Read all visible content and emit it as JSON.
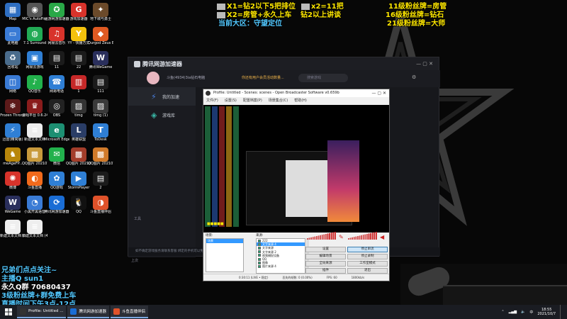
{
  "overlay": {
    "line1_left": "X1=钻2以下5把排位",
    "line1_mid": "x2=11把",
    "line2_left": "X2=房管+永久上车",
    "line2_mid": "钻2以上讲谈",
    "line3_left": "当前大区：守望定位",
    "right1": "11级粉丝牌=房管",
    "right2": "16级粉丝牌=钻石",
    "right3": "21级粉丝牌=大师",
    "bottom1": "兄弟们点点关注~",
    "bottom2": "主播Q  sun1",
    "bottom3": "永久Q群 70680437",
    "bottom4": "3级粉丝牌+群免费上车",
    "bottom5": "直播时间下午3点-12点"
  },
  "desktop_icons": [
    {
      "label": "Map",
      "color": "#2f6fc2",
      "glyph": "▦"
    },
    {
      "label": "MIC's AutoFire",
      "color": "#555555",
      "glyph": "◉"
    },
    {
      "label": "迅游网游加速器",
      "color": "#29a847",
      "glyph": "✪"
    },
    {
      "label": "游戏加速器",
      "color": "#d8332b",
      "glyph": "G"
    },
    {
      "label": "地下城与勇士",
      "color": "#6b4a2a",
      "glyph": "✦"
    },
    {
      "label": "此电脑",
      "color": "#3a7bd5",
      "glyph": "▭"
    },
    {
      "label": "7.1 Surround",
      "color": "#22aa55",
      "glyph": "◍"
    },
    {
      "label": "网易云音乐",
      "color": "#d8332b",
      "glyph": "♫"
    },
    {
      "label": "YY - 快播方式",
      "color": "#f4c20d",
      "glyph": "Y"
    },
    {
      "label": "Durgod Zeus Engine",
      "color": "#e05a22",
      "glyph": "◆"
    },
    {
      "label": "回收站",
      "color": "#4a6c8c",
      "glyph": "♻"
    },
    {
      "label": "网易云游戏",
      "color": "#2f7fd5",
      "glyph": "▣"
    },
    {
      "label": "11",
      "color": "#1b1b1b",
      "glyph": "▤"
    },
    {
      "label": "22",
      "color": "#1b1b1b",
      "glyph": "▤"
    },
    {
      "label": "腾讯WeGame",
      "color": "#2a2f5c",
      "glyph": "W"
    },
    {
      "label": "网络",
      "color": "#3a7bd5",
      "glyph": "◫"
    },
    {
      "label": "QQ音乐",
      "color": "#22b14c",
      "glyph": "♪"
    },
    {
      "label": "网易电话",
      "color": "#2f7fd5",
      "glyph": "☎"
    },
    {
      "label": "1",
      "color": "#c62828",
      "glyph": "▥"
    },
    {
      "label": "111",
      "color": "#1b1b1b",
      "glyph": "▤"
    },
    {
      "label": "Frozen Throne",
      "color": "#5c1a1a",
      "glyph": "❄"
    },
    {
      "label": "游戏平台 0.6.24",
      "color": "#8a1c1c",
      "glyph": "♛"
    },
    {
      "label": "OBS",
      "color": "#222222",
      "glyph": "◎"
    },
    {
      "label": "timg",
      "color": "#333333",
      "glyph": "▨"
    },
    {
      "label": "timg (1)",
      "color": "#3a3a3a",
      "glyph": "▨"
    },
    {
      "label": "迅雷(精简版)",
      "color": "#2f7fd5",
      "glyph": "⚡"
    },
    {
      "label": "新建文本文档",
      "color": "#eeeeee",
      "glyph": "≡"
    },
    {
      "label": "Microsoft Edge",
      "color": "#1d8f72",
      "glyph": "e"
    },
    {
      "label": "英雄联盟",
      "color": "#2a3d66",
      "glyph": "L"
    },
    {
      "label": "ToDesk",
      "color": "#2f7fd5",
      "glyph": "T"
    },
    {
      "label": "meAgeFP...",
      "color": "#b8860b",
      "glyph": "♞"
    },
    {
      "label": "QQ图片 20210731...",
      "color": "#c89a3c",
      "glyph": "▩"
    },
    {
      "label": "微信",
      "color": "#22b14c",
      "glyph": "✉"
    },
    {
      "label": "QQ图片 20210731...",
      "color": "#a33d2a",
      "glyph": "▩"
    },
    {
      "label": "QQ图片 20210731...",
      "color": "#d07a2a",
      "glyph": "▩"
    },
    {
      "label": "微博",
      "color": "#d8332b",
      "glyph": "✺"
    },
    {
      "label": "斗鱼直播",
      "color": "#f26a1b",
      "glyph": "◐"
    },
    {
      "label": "QQ游戏",
      "color": "#2f7fd5",
      "glyph": "✿"
    },
    {
      "label": "StormPlayer",
      "color": "#2f7fd5",
      "glyph": "▶"
    },
    {
      "label": "2",
      "color": "#1b1b1b",
      "glyph": "▤"
    },
    {
      "label": "WeGame",
      "color": "#2a2f5c",
      "glyph": "W"
    },
    {
      "label": "小黑开黑语音",
      "color": "#3a7bd5",
      "glyph": "◔"
    },
    {
      "label": "腾讯网游加速器",
      "color": "#1a6dd5",
      "glyph": "⟳"
    },
    {
      "label": "QQ",
      "color": "#111111",
      "glyph": "🐧"
    },
    {
      "label": "斗鱼直播伴侣",
      "color": "#e0522a",
      "glyph": "◑"
    },
    {
      "label": "新建文本文档 (3)",
      "color": "#eeeeee",
      "glyph": "≡"
    },
    {
      "label": "新建文本文档 (4)",
      "color": "#eeeeee",
      "glyph": "≡"
    }
  ],
  "launcher": {
    "brand": "腾讯网游加速器",
    "user_id": "斗鱼(4934)3ia钻石电脑",
    "search_placeholder": "搜索游戏",
    "notice": "你还有用户会员活动数量...",
    "nav": [
      {
        "label": "我的加速",
        "icon": "bolt-icon"
      },
      {
        "label": "游戏库",
        "icon": "cube-icon"
      }
    ],
    "side_text_1": "工具",
    "side_text_2": "上次",
    "status": "如不确定游戏服务请联系客服  绑定的手机可以免费下载游戏"
  },
  "obs": {
    "title": "Profile: Untitled - Scenes: scenes - Open Broadcaster Software v0.659b",
    "menu": [
      "文件(F)",
      "设置(S)",
      "配置档案(P)",
      "场景集合(C)",
      "帮助(H)"
    ],
    "scenes_label": "场景:",
    "sources_label": "来源:",
    "scene_selected": "场景",
    "sources": [
      {
        "label": "222",
        "checked": true,
        "selected": false
      },
      {
        "label": "文字来源 4",
        "checked": true,
        "selected": true
      },
      {
        "label": "文字来源",
        "checked": true,
        "selected": false
      },
      {
        "label": "文字来源 2",
        "checked": true,
        "selected": false
      },
      {
        "label": "视频捕捉设备",
        "checked": true,
        "selected": false
      },
      {
        "label": "QQ",
        "checked": true,
        "selected": false
      },
      {
        "label": "图像",
        "checked": true,
        "selected": false
      },
      {
        "label": "图片来源 4",
        "checked": true,
        "selected": false
      }
    ],
    "buttons": [
      {
        "label": "设置",
        "highlight": false
      },
      {
        "label": "停止串流",
        "highlight": true
      },
      {
        "label": "编辑场景",
        "highlight": false
      },
      {
        "label": "停止录制",
        "highlight": false
      },
      {
        "label": "全局来源",
        "highlight": false
      },
      {
        "label": "工作室模式",
        "highlight": false
      },
      {
        "label": "插件",
        "highlight": false
      },
      {
        "label": "退出",
        "highlight": false
      }
    ],
    "status": [
      "0:30:11 (LIVE • 稳定)",
      "丢失的帧数: 0 (0.00%)",
      "FPS: 60",
      "1800kb/s"
    ]
  },
  "taskbar": {
    "apps": [
      {
        "label": "Profile: Untitled ...",
        "color": "#333333"
      },
      {
        "label": "腾讯网游加速器",
        "color": "#1a6dd5"
      },
      {
        "label": "斗鱼直播伴侣",
        "color": "#e0522a"
      }
    ],
    "time": "18:55",
    "date": "2021/10/7"
  }
}
